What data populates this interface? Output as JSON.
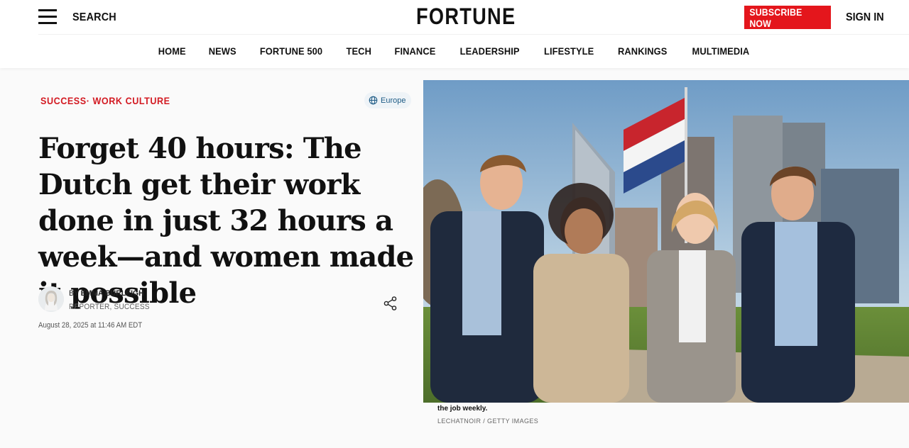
{
  "header": {
    "search_label": "SEARCH",
    "logo": "FORTUNE",
    "subscribe_label": "SUBSCRIBE NOW",
    "signin_label": "SIGN IN",
    "accent_color": "#e4161c"
  },
  "nav": {
    "items": [
      {
        "label": "HOME"
      },
      {
        "label": "NEWS"
      },
      {
        "label": "FORTUNE 500"
      },
      {
        "label": "TECH"
      },
      {
        "label": "FINANCE"
      },
      {
        "label": "LEADERSHIP"
      },
      {
        "label": "LIFESTYLE"
      },
      {
        "label": "RANKINGS"
      },
      {
        "label": "MULTIMEDIA"
      }
    ]
  },
  "article": {
    "section": "SUCCESS· WORK CULTURE",
    "region": "Europe",
    "headline": "Forget 40 hours: The Dutch get their work done in just 32 hours a week—and women made it possible",
    "author_prefix": "BY",
    "author_name": "EMMA BURLEIGH",
    "author_role": "REPORTER, SUCCESS",
    "date": "August 28, 2025 at 11:46 AM EDT"
  },
  "photo": {
    "caption": "the job weekly.",
    "credit": "LECHATNOIR / GETTY IMAGES"
  },
  "icons": {
    "menu": "hamburger-menu-icon",
    "globe": "globe-icon",
    "share": "share-icon"
  }
}
